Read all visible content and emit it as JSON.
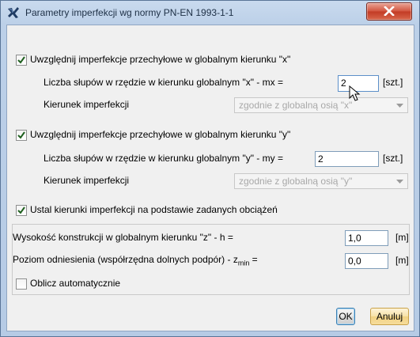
{
  "window": {
    "title": "Parametry imperfekcji wg normy PN-EN 1993-1-1"
  },
  "x_section": {
    "checkbox_label": "Uwzględnij imperfekcje przechyłowe w globalnym kierunku \"x\"",
    "checked": true,
    "columns_label": "Liczba słupów w rzędzie w kierunku globalnym \"x\" - mx =",
    "columns_value": "2",
    "unit": "[szt.]",
    "direction_label": "Kierunek imperfekcji",
    "direction_value": "zgodnie z globalną osią \"x\""
  },
  "y_section": {
    "checkbox_label": "Uwzględnij imperfekcje przechyłowe w globalnym kierunku \"y\"",
    "checked": true,
    "columns_label": "Liczba słupów w rzędzie w kierunku globalnym \"y\" - my =",
    "columns_value": "2",
    "unit": "[szt.]",
    "direction_label": "Kierunek imperfekcji",
    "direction_value": "zgodnie z globalną osią \"y\""
  },
  "loads_section": {
    "checkbox_label": "Ustal kierunki imperfekcji na podstawie zadanych obciążeń",
    "checked": true
  },
  "height_group": {
    "height_label": "Wysokość konstrukcji w globalnym kierunku \"z\" - h =",
    "height_value": "1,0",
    "height_unit": "[m]",
    "zmin_label_prefix": "Poziom odniesienia (współrzędna dolnych podpór) - z",
    "zmin_label_sub": "min",
    "zmin_label_suffix": " =",
    "zmin_value": "0,0",
    "zmin_unit": "[m]",
    "auto_label": "Oblicz automatycznie",
    "auto_checked": false
  },
  "buttons": {
    "ok": "OK",
    "cancel": "Anuluj"
  },
  "colors": {
    "title_bar": "#bcd0e8",
    "close_button": "#c9432c",
    "checkmark": "#1e5f1e",
    "disabled_text": "#a8a8a8"
  }
}
